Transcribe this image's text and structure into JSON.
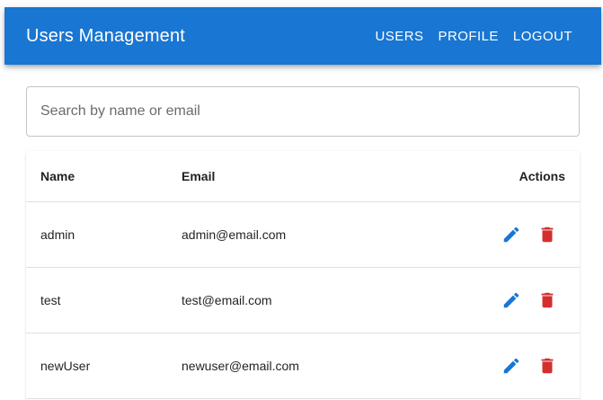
{
  "header": {
    "title": "Users Management",
    "nav": [
      "USERS",
      "PROFILE",
      "LOGOUT"
    ]
  },
  "search": {
    "placeholder": "Search by name or email",
    "value": ""
  },
  "table": {
    "columns": [
      "Name",
      "Email",
      "Actions"
    ],
    "rows": [
      {
        "name": "admin",
        "email": "admin@email.com"
      },
      {
        "name": "test",
        "email": "test@email.com"
      },
      {
        "name": "newUser",
        "email": "newuser@email.com"
      }
    ]
  },
  "colors": {
    "primary": "#1976d2",
    "edit_icon": "#1976d2",
    "delete_icon": "#d32f2f"
  },
  "icons": {
    "edit": "edit-icon",
    "delete": "delete-icon"
  }
}
